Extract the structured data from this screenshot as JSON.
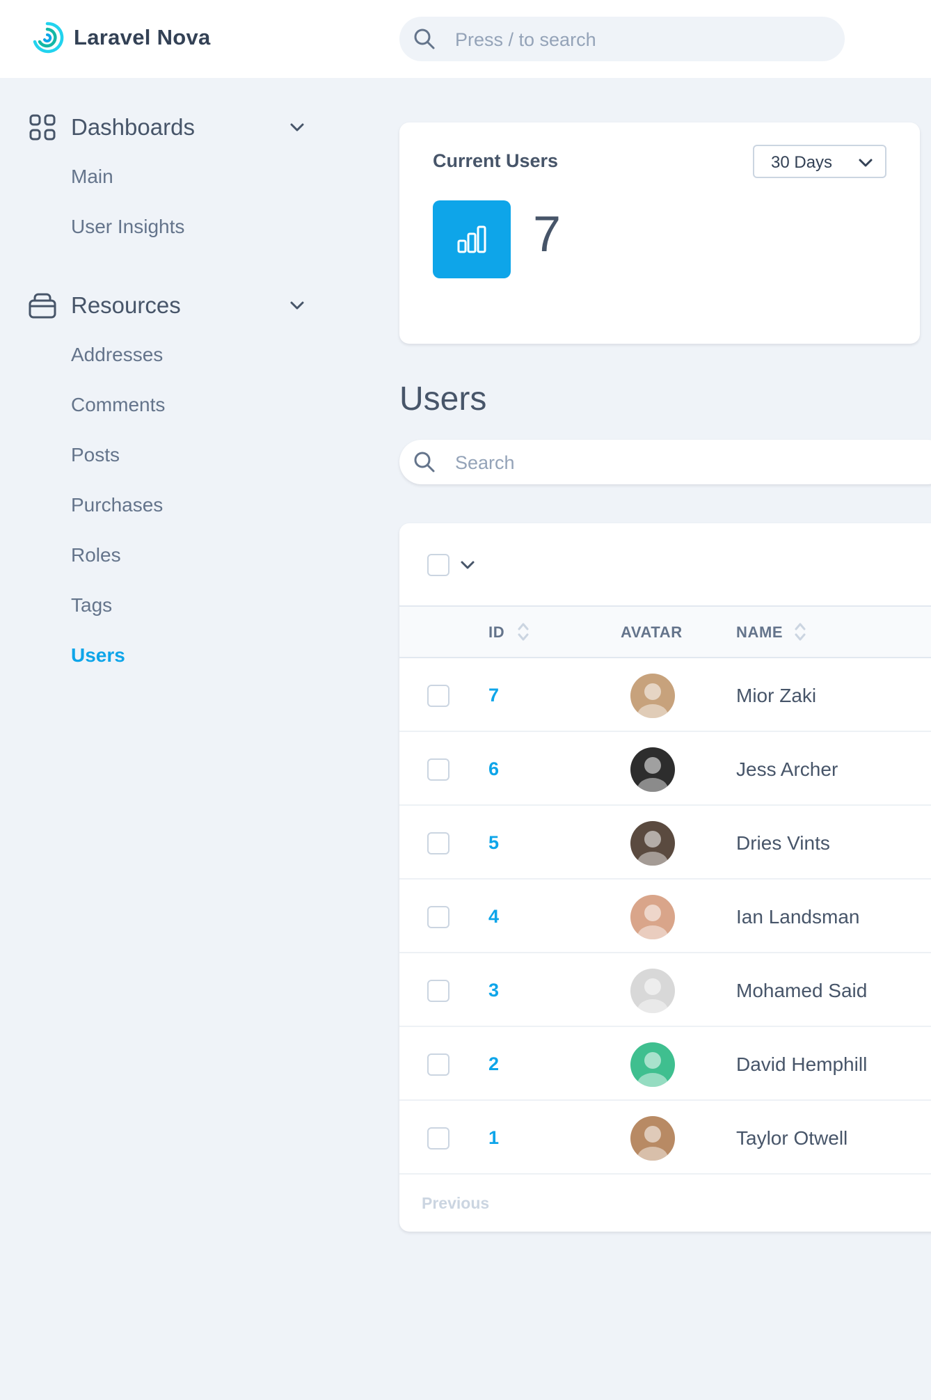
{
  "brand": {
    "name": "Laravel Nova",
    "accent": "#0ea5e9"
  },
  "global_search": {
    "placeholder": "Press / to search"
  },
  "sidebar": {
    "dashboards": {
      "label": "Dashboards",
      "items": [
        {
          "label": "Main"
        },
        {
          "label": "User Insights"
        }
      ]
    },
    "resources": {
      "label": "Resources",
      "items": [
        {
          "label": "Addresses"
        },
        {
          "label": "Comments"
        },
        {
          "label": "Posts"
        },
        {
          "label": "Purchases"
        },
        {
          "label": "Roles"
        },
        {
          "label": "Tags"
        },
        {
          "label": "Users"
        }
      ],
      "active": "Users"
    }
  },
  "metric": {
    "title": "Current Users",
    "range": "30 Days",
    "value": "7"
  },
  "resource": {
    "heading": "Users",
    "search_placeholder": "Search",
    "columns": {
      "id": "ID",
      "avatar": "AVATAR",
      "name": "NAME"
    },
    "rows": [
      {
        "id": "7",
        "name": "Mior Zaki",
        "avatar_color": "#c7a27c"
      },
      {
        "id": "6",
        "name": "Jess Archer",
        "avatar_color": "#2d2d2d"
      },
      {
        "id": "5",
        "name": "Dries Vints",
        "avatar_color": "#5a4a3f"
      },
      {
        "id": "4",
        "name": "Ian Landsman",
        "avatar_color": "#d9a58a"
      },
      {
        "id": "3",
        "name": "Mohamed Said",
        "avatar_color": "#d8d8d8"
      },
      {
        "id": "2",
        "name": "David Hemphill",
        "avatar_color": "#3fbf8f"
      },
      {
        "id": "1",
        "name": "Taylor Otwell",
        "avatar_color": "#b88a64"
      }
    ],
    "pagination": {
      "previous": "Previous"
    }
  }
}
